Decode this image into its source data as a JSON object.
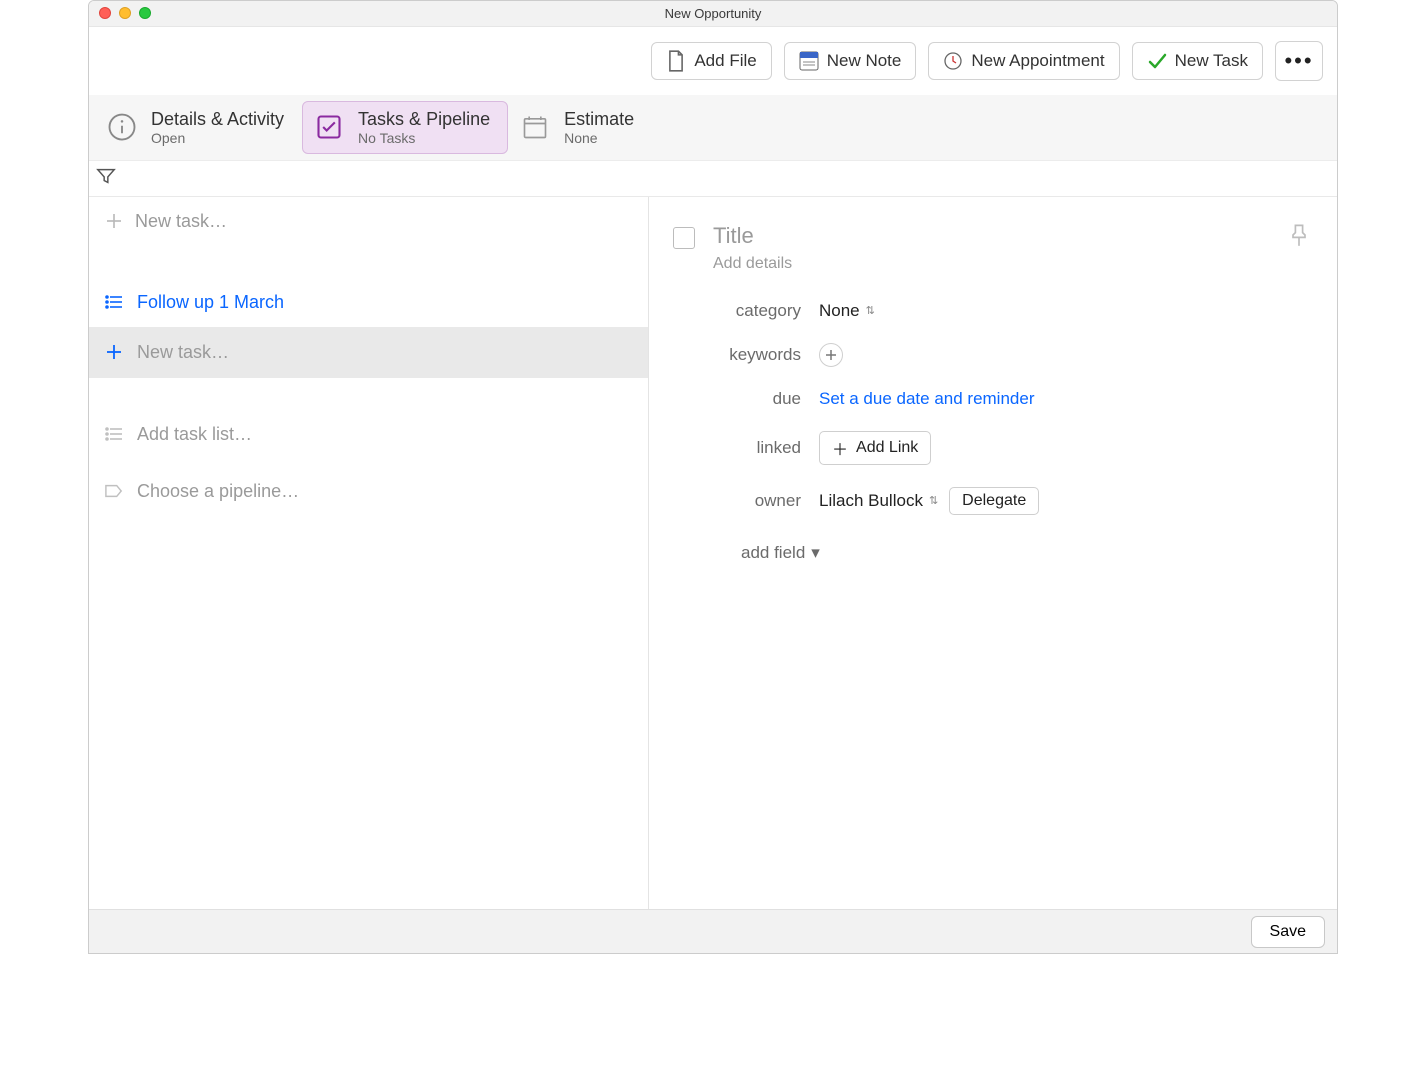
{
  "window": {
    "title": "New Opportunity"
  },
  "toolbar": {
    "add_file": "Add File",
    "new_note": "New Note",
    "new_appointment": "New Appointment",
    "new_task": "New Task"
  },
  "tabs": {
    "details": {
      "label": "Details & Activity",
      "sub": "Open"
    },
    "tasks": {
      "label": "Tasks & Pipeline",
      "sub": "No Tasks"
    },
    "estimate": {
      "label": "Estimate",
      "sub": "None"
    }
  },
  "left_pane": {
    "new_task_placeholder": "New task…",
    "task_list_name": "Follow up 1 March",
    "add_task_list_placeholder": "Add task list…",
    "choose_pipeline_placeholder": "Choose a pipeline…"
  },
  "detail": {
    "title_placeholder": "Title",
    "subtitle_placeholder": "Add details",
    "category_label": "category",
    "category_value": "None",
    "keywords_label": "keywords",
    "due_label": "due",
    "due_value": "Set a due date and reminder",
    "linked_label": "linked",
    "add_link_label": "Add Link",
    "owner_label": "owner",
    "owner_value": "Lilach Bullock",
    "delegate_label": "Delegate",
    "add_field_label": "add field"
  },
  "footer": {
    "save": "Save"
  }
}
